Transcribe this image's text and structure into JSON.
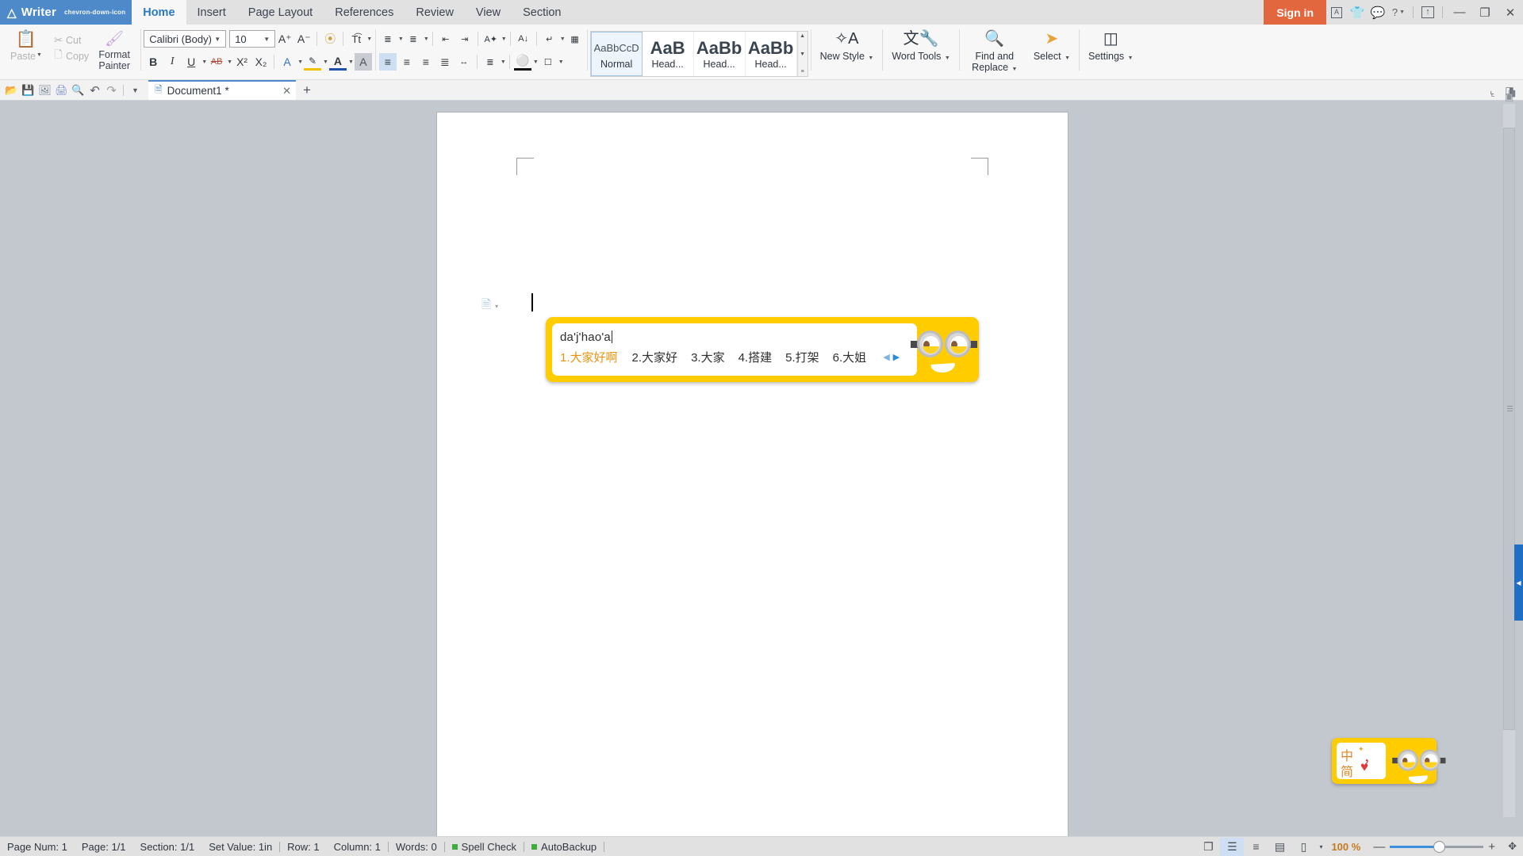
{
  "titlebar": {
    "brand": "Writer",
    "brand_logo_icon": "writer-logo-icon",
    "brand_caret_icon": "chevron-down-icon",
    "menu": [
      {
        "label": "Home",
        "active": true
      },
      {
        "label": "Insert",
        "active": false
      },
      {
        "label": "Page Layout",
        "active": false
      },
      {
        "label": "References",
        "active": false
      },
      {
        "label": "Review",
        "active": false
      },
      {
        "label": "View",
        "active": false
      },
      {
        "label": "Section",
        "active": false
      }
    ],
    "signin_label": "Sign in",
    "right_icons": [
      {
        "name": "app-switch-icon",
        "glyph": "⎘"
      },
      {
        "name": "tshirt-skin-icon",
        "glyph": "Ŧ"
      },
      {
        "name": "feedback-chat-icon",
        "glyph": "◕"
      },
      {
        "name": "help-icon",
        "glyph": "?"
      },
      {
        "name": "help-caret-icon",
        "glyph": "▾"
      },
      {
        "name": "share-upload-icon",
        "glyph": "↑"
      },
      {
        "name": "minimize-icon",
        "glyph": "—"
      },
      {
        "name": "restore-icon",
        "glyph": "❐"
      },
      {
        "name": "close-icon",
        "glyph": "✕"
      }
    ]
  },
  "ribbon": {
    "clipboard": {
      "paste_label": "Paste",
      "paste_icon": "paste-icon",
      "paste_caret": "▾",
      "cut_label": "Cut",
      "cut_icon": "scissors-icon",
      "copy_label": "Copy",
      "copy_icon": "copy-icon",
      "format_painter_line1": "Format",
      "format_painter_line2": "Painter",
      "format_painter_icon": "paintbrush-icon"
    },
    "font": {
      "family_value": "Calibri (Body)",
      "size_value": "10",
      "grow_font": "A⁺",
      "shrink_font": "A⁻",
      "clear_format_icon": "clear-formatting-icon",
      "phonetic_icon": "text-tools-icon",
      "bold": "B",
      "italic": "I",
      "underline": "U",
      "strikethrough": "AB",
      "superscript": "X²",
      "subscript": "X₂",
      "text_effects_icon": "text-effects-icon",
      "highlight_icon": "highlight-color-icon",
      "font_color_icon": "font-color-icon",
      "char_shading_icon": "character-shading-icon"
    },
    "paragraph": {
      "bullets_icon": "bullet-list-icon",
      "numbering_icon": "numbered-list-icon",
      "decrease_indent_icon": "decrease-indent-icon",
      "increase_indent_icon": "increase-indent-icon",
      "asian_layout_icon": "asian-layout-icon",
      "sort_icon": "sort-az-icon",
      "show_marks_icon": "show-formatting-marks-icon",
      "borders_grid_icon": "table-grid-icon",
      "align_left_icon": "align-left-icon",
      "align_center_icon": "align-center-icon",
      "align_right_icon": "align-right-icon",
      "align_justify_icon": "align-justify-icon",
      "distribute_icon": "distribute-text-icon",
      "line_spacing_icon": "line-spacing-icon",
      "shading_icon": "paragraph-shading-icon",
      "border_icon": "paragraph-border-icon"
    },
    "styles": {
      "items": [
        {
          "preview": "AaBbCcD",
          "name": "Normal",
          "selected": true,
          "big": false
        },
        {
          "preview": "AaB",
          "name": "Head...",
          "selected": false,
          "big": true
        },
        {
          "preview": "AaBb",
          "name": "Head...",
          "selected": false,
          "big": true
        },
        {
          "preview": "AaBb",
          "name": "Head...",
          "selected": false,
          "big": true
        }
      ],
      "scroll_up_icon": "▲",
      "scroll_down_icon": "▼",
      "more_icon": "≡"
    },
    "buttons": [
      {
        "label": "New Style",
        "icon": "new-style-icon",
        "glyph": "A",
        "caret": true
      },
      {
        "label": "Word Tools",
        "icon": "word-tools-icon",
        "glyph": "文",
        "caret": true
      },
      {
        "label": "Find and",
        "label2": "Replace",
        "icon": "find-replace-icon",
        "glyph": "⌾",
        "caret": true
      },
      {
        "label": "Select",
        "icon": "select-cursor-icon",
        "glyph": "➤",
        "caret": true
      },
      {
        "label": "Settings",
        "icon": "settings-icon",
        "glyph": "⌗",
        "caret": true
      }
    ]
  },
  "tabbar": {
    "quick_access": [
      {
        "name": "open-folder-icon",
        "glyph": "📂"
      },
      {
        "name": "save-icon",
        "glyph": "💾"
      },
      {
        "name": "export-pdf-icon",
        "glyph": "⎙"
      },
      {
        "name": "print-icon",
        "glyph": "⎙"
      },
      {
        "name": "print-preview-icon",
        "glyph": "⌕"
      },
      {
        "name": "undo-icon",
        "glyph": "↶"
      },
      {
        "name": "redo-icon",
        "glyph": "↷"
      },
      {
        "name": "customize-qat-caret-icon",
        "glyph": "▾"
      }
    ],
    "document_tab": {
      "title": "Document1 *",
      "doc_icon": "document-icon",
      "close_icon": "✕"
    },
    "new_tab_icon": "+",
    "right_icons": [
      {
        "name": "restore-tab-icon",
        "glyph": "└"
      },
      {
        "name": "tab-options-icon",
        "glyph": "◰"
      }
    ]
  },
  "document": {
    "paste_options_icon": "paste-options-icon",
    "paste_options_caret": "▾",
    "margin_marker": "page-margin-marker",
    "text_caret": "text-cursor"
  },
  "ime": {
    "pinyin": "da'j'hao'a",
    "candidates": [
      {
        "index": "1.",
        "text": "大家好啊",
        "selected": true
      },
      {
        "index": "2.",
        "text": "大家好",
        "selected": false
      },
      {
        "index": "3.",
        "text": "大家",
        "selected": false
      },
      {
        "index": "4.",
        "text": "搭建",
        "selected": false
      },
      {
        "index": "5.",
        "text": "打架",
        "selected": false
      },
      {
        "index": "6.",
        "text": "大姐",
        "selected": false
      }
    ],
    "prev_page_icon": "◀",
    "next_page_icon": "▶",
    "mascot_icon": "minion-mascot-icon",
    "bg_color": "#ffcc00",
    "selected_color": "#e8930b"
  },
  "ime_bar": {
    "mode_cn": "中",
    "mode_simplified": "简",
    "star_glyph": "✦",
    "punctuation_glyph": "，",
    "heart_glyph": "♥",
    "mascot_icon": "minion-mascot-icon"
  },
  "rightpanel": {
    "toggle_icon": "◀",
    "nav_icon": "nav-pane-icon",
    "scroll_up_icon": "▲"
  },
  "statusbar": {
    "items": [
      {
        "label": "Page Num: 1",
        "name": "page-num"
      },
      {
        "label": "Page: 1/1",
        "name": "page-count"
      },
      {
        "label": "Section: 1/1",
        "name": "section"
      },
      {
        "label": "Set Value: 1in",
        "name": "set-value"
      },
      {
        "label": "Row: 1",
        "name": "row"
      },
      {
        "label": "Column: 1",
        "name": "column"
      },
      {
        "label": "Words: 0",
        "name": "word-count"
      },
      {
        "label": "Spell Check",
        "name": "spell-check",
        "dot": true
      },
      {
        "label": "AutoBackup",
        "name": "autobackup",
        "dot": true
      }
    ],
    "view_icons": [
      {
        "name": "full-screen-view-icon",
        "glyph": "❐",
        "active": false
      },
      {
        "name": "print-layout-view-icon",
        "glyph": "☰",
        "active": true
      },
      {
        "name": "outline-view-icon",
        "glyph": "≡",
        "active": false
      },
      {
        "name": "web-layout-view-icon",
        "glyph": "▤",
        "active": false
      },
      {
        "name": "night-mode-icon",
        "glyph": "▯",
        "active": false
      }
    ],
    "night_caret": "▾",
    "zoom_percent": "100 %",
    "zoom_out_icon": "—",
    "zoom_in_icon": "+",
    "fit_page_icon": "✥"
  }
}
